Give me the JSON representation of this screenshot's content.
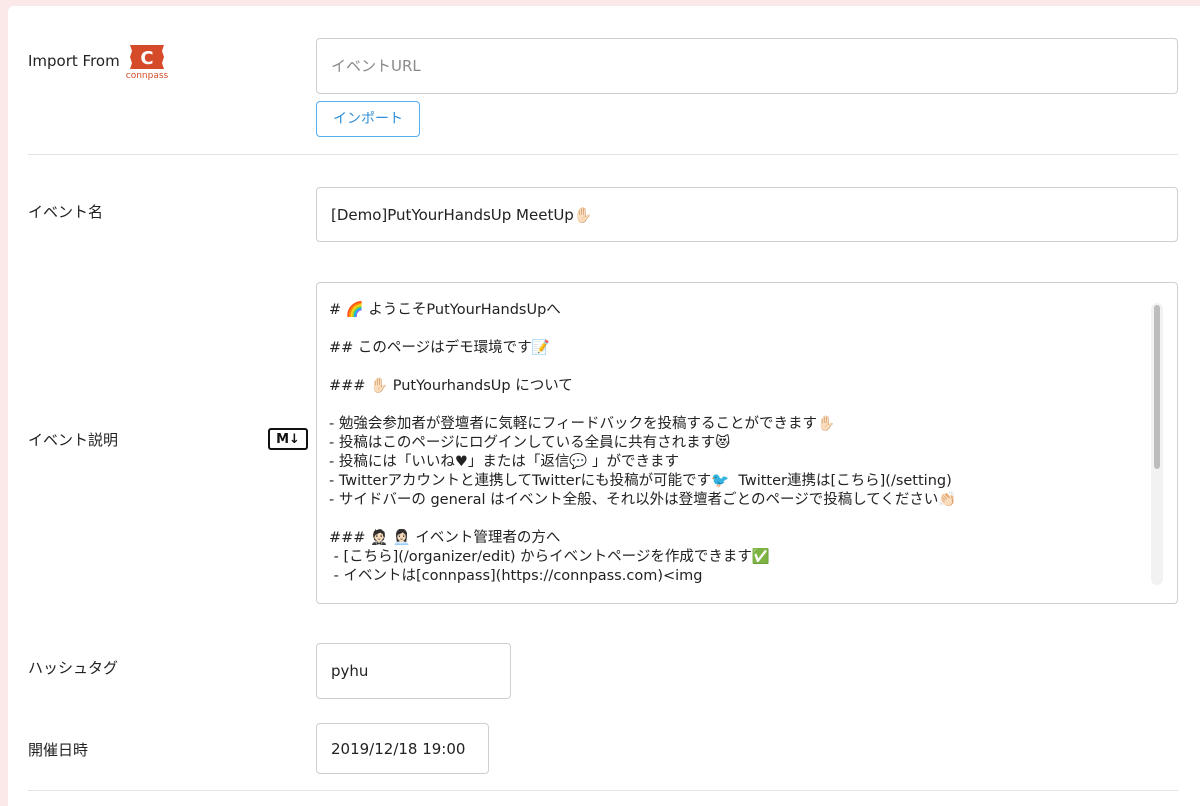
{
  "import": {
    "label": "Import From",
    "logo_text": "connpass",
    "logo_letter": "C",
    "url_placeholder": "イベントURL",
    "button_label": "インポート"
  },
  "event_name": {
    "label": "イベント名",
    "value": "[Demo]PutYourHandsUp MeetUp✋🏻"
  },
  "event_description": {
    "label": "イベント説明",
    "markdown_badge": "M↓",
    "lines": [
      "# 🌈 ようこそPutYourHandsUpへ",
      "",
      "## このページはデモ環境です📝",
      "",
      "### ✋🏻 PutYourhandsUp について",
      "",
      "- 勉強会参加者が登壇者に気軽にフィードバックを投稿することができます✋🏻",
      "- 投稿はこのページにログインしている全員に共有されます😻",
      "- 投稿には「いいね♥」または「返信💬 」ができます",
      "- Twitterアカウントと連携してTwitterにも投稿が可能です🐦  Twitter連携は[こちら](/setting)",
      "- サイドバーの general はイベント全般、それ以外は登壇者ごとのページで投稿してください👏🏻",
      "",
      "### 🤵🏻 👩🏻‍💼 イベント管理者の方へ",
      " - [こちら](/organizer/edit) からイベントページを作成できます✅",
      " - イベントは[connpass](https://connpass.com)<img"
    ]
  },
  "hashtag": {
    "label": "ハッシュタグ",
    "value": "pyhu"
  },
  "datetime": {
    "label": "開催日時",
    "value": "2019/12/18 19:00"
  },
  "colors": {
    "page_bg": "#fbe9ea",
    "logo_red": "#d54b2a",
    "button_blue": "#2f8fd8"
  }
}
